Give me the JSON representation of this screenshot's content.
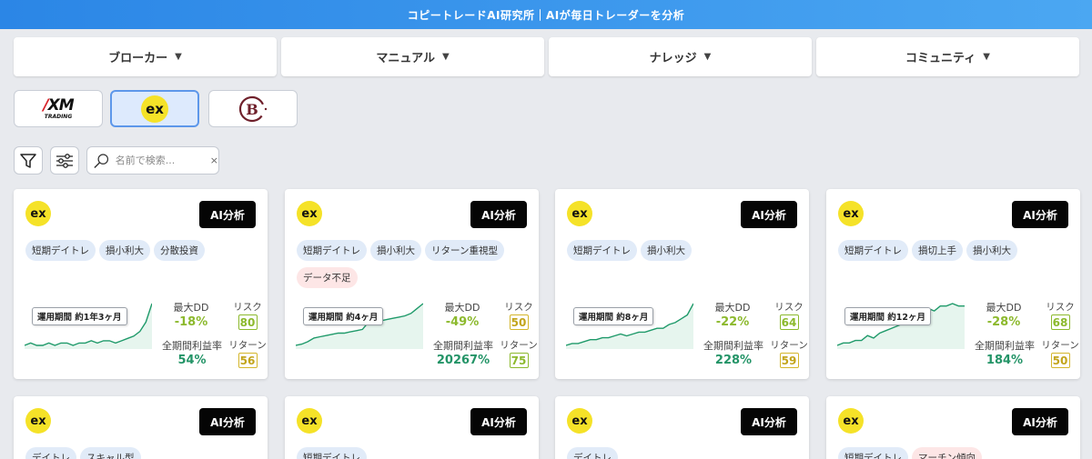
{
  "header": {
    "title": "コピートレードAI研究所｜AIが毎日トレーダーを分析"
  },
  "nav": [
    {
      "label": "ブローカー",
      "caret": "▼"
    },
    {
      "label": "マニュアル",
      "caret": "▼"
    },
    {
      "label": "ナレッジ",
      "caret": "▼"
    },
    {
      "label": "コミュニティ",
      "caret": "▼"
    }
  ],
  "brokers": {
    "xm": {
      "brand": "XM",
      "sub": "TRADING"
    },
    "exness": {
      "brand": "ex"
    },
    "third": {
      "brand": "B"
    },
    "active": "exness"
  },
  "tools": {
    "search_placeholder": "名前で検索...",
    "clear": "×"
  },
  "colors": {
    "accent": "#2b86e6",
    "positive": "#239467",
    "negative": "#8cb92d",
    "exness_yellow": "#f5e228"
  },
  "cards": [
    {
      "logo": "ex",
      "ai_label": "AI分析",
      "tags": [
        {
          "t": "短期デイトレ"
        },
        {
          "t": "損小利大"
        },
        {
          "t": "分散投資"
        }
      ],
      "period": "運用期間 約1年3ヶ月",
      "maxdd_label": "最大DD",
      "maxdd": "-18%",
      "ret_label": "全期間利益率",
      "ret": "54%",
      "risk_label": "リスク",
      "risk": "80",
      "risk_color": "green",
      "return_label": "リターン",
      "return_score": "56",
      "return_color": "yellow",
      "chart": {
        "values": [
          10,
          11,
          10,
          10,
          11,
          10,
          11,
          11,
          10,
          11,
          11,
          12,
          11,
          12,
          12,
          11,
          12,
          13,
          14,
          16,
          20,
          28
        ]
      }
    },
    {
      "logo": "ex",
      "ai_label": "AI分析",
      "tags": [
        {
          "t": "短期デイトレ"
        },
        {
          "t": "損小利大"
        },
        {
          "t": "リターン重視型"
        },
        {
          "t": "データ不足",
          "warn": true
        }
      ],
      "period": "運用期間 約4ヶ月",
      "maxdd_label": "最大DD",
      "maxdd": "-49%",
      "ret_label": "全期間利益率",
      "ret": "20267%",
      "risk_label": "リスク",
      "risk": "50",
      "risk_color": "yellow",
      "return_label": "リターン",
      "return_score": "75",
      "return_color": "green",
      "chart": {
        "values": [
          2,
          3,
          5,
          8,
          9,
          10,
          11,
          12,
          12,
          13,
          14,
          15,
          21,
          22,
          22,
          23,
          24,
          25,
          26,
          28,
          32,
          36
        ]
      }
    },
    {
      "logo": "ex",
      "ai_label": "AI分析",
      "tags": [
        {
          "t": "短期デイトレ"
        },
        {
          "t": "損小利大"
        }
      ],
      "period": "運用期間 約8ヶ月",
      "maxdd_label": "最大DD",
      "maxdd": "-22%",
      "ret_label": "全期間利益率",
      "ret": "228%",
      "risk_label": "リスク",
      "risk": "64",
      "risk_color": "green",
      "return_label": "リターン",
      "return_score": "59",
      "return_color": "yellow",
      "chart": {
        "values": [
          8,
          9,
          9,
          10,
          11,
          11,
          12,
          12,
          13,
          14,
          13,
          14,
          15,
          15,
          16,
          17,
          17,
          19,
          20,
          22,
          24,
          30
        ]
      }
    },
    {
      "logo": "ex",
      "ai_label": "AI分析",
      "tags": [
        {
          "t": "短期デイトレ"
        },
        {
          "t": "損切上手"
        },
        {
          "t": "損小利大"
        }
      ],
      "period": "運用期間 約12ヶ月",
      "maxdd_label": "最大DD",
      "maxdd": "-28%",
      "ret_label": "全期間利益率",
      "ret": "184%",
      "risk_label": "リスク",
      "risk": "68",
      "risk_color": "green",
      "return_label": "リターン",
      "return_score": "50",
      "return_color": "yellow",
      "chart": {
        "values": [
          10,
          11,
          11,
          12,
          12,
          14,
          13,
          15,
          16,
          17,
          18,
          19,
          21,
          22,
          24,
          25,
          24,
          26,
          26,
          27,
          26,
          26
        ]
      }
    }
  ],
  "row2": [
    {
      "logo": "ex",
      "ai_label": "AI分析",
      "tags": [
        {
          "t": "デイトレ"
        },
        {
          "t": "スキャル型"
        }
      ]
    },
    {
      "logo": "ex",
      "ai_label": "AI分析",
      "tags": [
        {
          "t": "短期デイトレ"
        }
      ]
    },
    {
      "logo": "ex",
      "ai_label": "AI分析",
      "tags": [
        {
          "t": "デイトレ"
        }
      ]
    },
    {
      "logo": "ex",
      "ai_label": "AI分析",
      "tags": [
        {
          "t": "短期デイトレ"
        },
        {
          "t": "マーチン傾向",
          "warn": true
        }
      ]
    }
  ]
}
